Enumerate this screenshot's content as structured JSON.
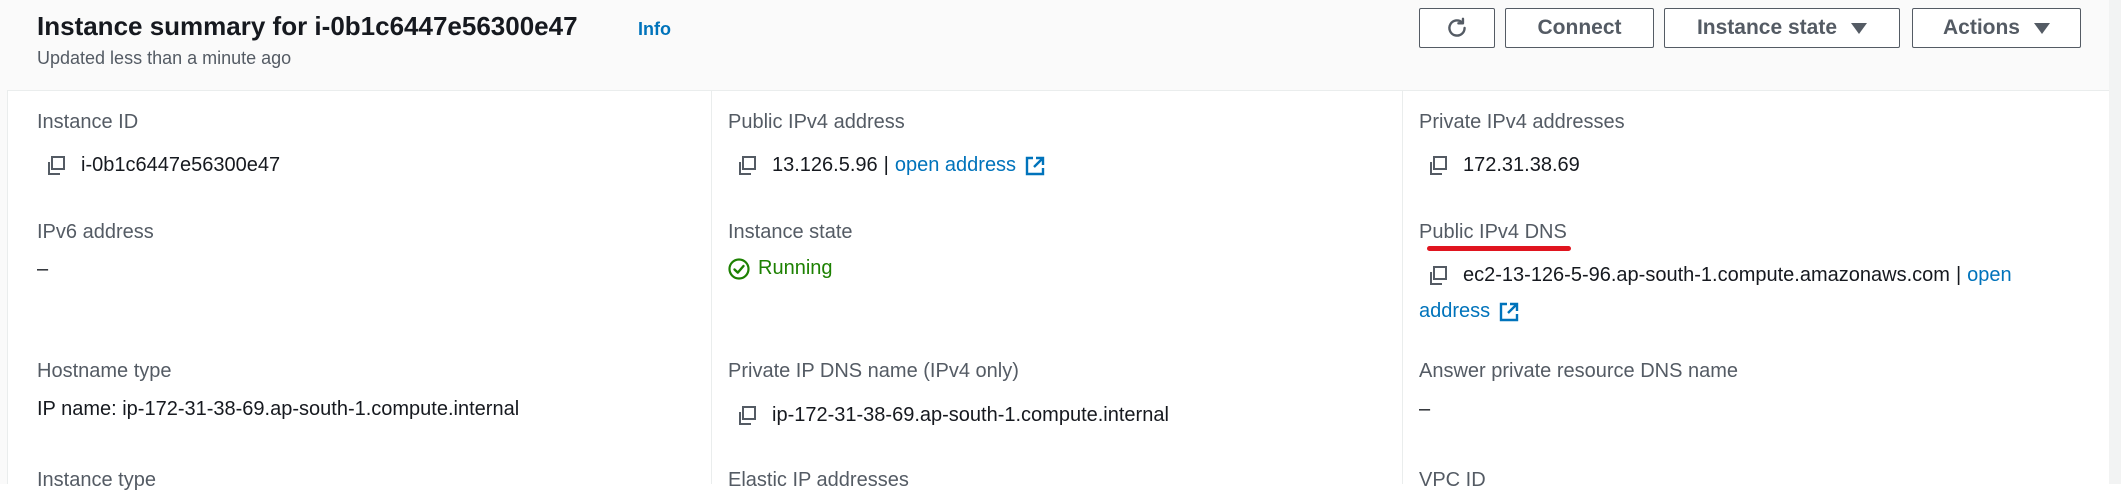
{
  "header": {
    "title": "Instance summary for i-0b1c6447e56300e47",
    "info": "Info",
    "updated": "Updated less than a minute ago",
    "buttons": {
      "connect": "Connect",
      "instance_state": "Instance state",
      "actions": "Actions"
    }
  },
  "fields": {
    "instance_id": {
      "label": "Instance ID",
      "value": "i-0b1c6447e56300e47"
    },
    "public_ipv4": {
      "label": "Public IPv4 address",
      "value": "13.126.5.96",
      "sep": "|",
      "link": "open address"
    },
    "private_ipv4": {
      "label": "Private IPv4 addresses",
      "value": "172.31.38.69"
    },
    "ipv6": {
      "label": "IPv6 address",
      "value": "–"
    },
    "instance_state": {
      "label": "Instance state",
      "value": "Running"
    },
    "public_dns": {
      "label": "Public IPv4 DNS",
      "value": "ec2-13-126-5-96.ap-south-1.compute.amazonaws.com",
      "sep": "|",
      "link_part1": "open",
      "link_part2": "address"
    },
    "hostname_type": {
      "label": "Hostname type",
      "value": "IP name: ip-172-31-38-69.ap-south-1.compute.internal"
    },
    "private_dns": {
      "label": "Private IP DNS name (IPv4 only)",
      "value": "ip-172-31-38-69.ap-south-1.compute.internal"
    },
    "answer_dns": {
      "label": "Answer private resource DNS name",
      "value": "–"
    },
    "instance_type": {
      "label": "Instance type"
    },
    "elastic_ip": {
      "label": "Elastic IP addresses"
    },
    "vpc_id": {
      "label": "VPC ID"
    }
  },
  "colors": {
    "link": "#0073bb",
    "running": "#1d8102",
    "annotation": "#e0151f"
  }
}
